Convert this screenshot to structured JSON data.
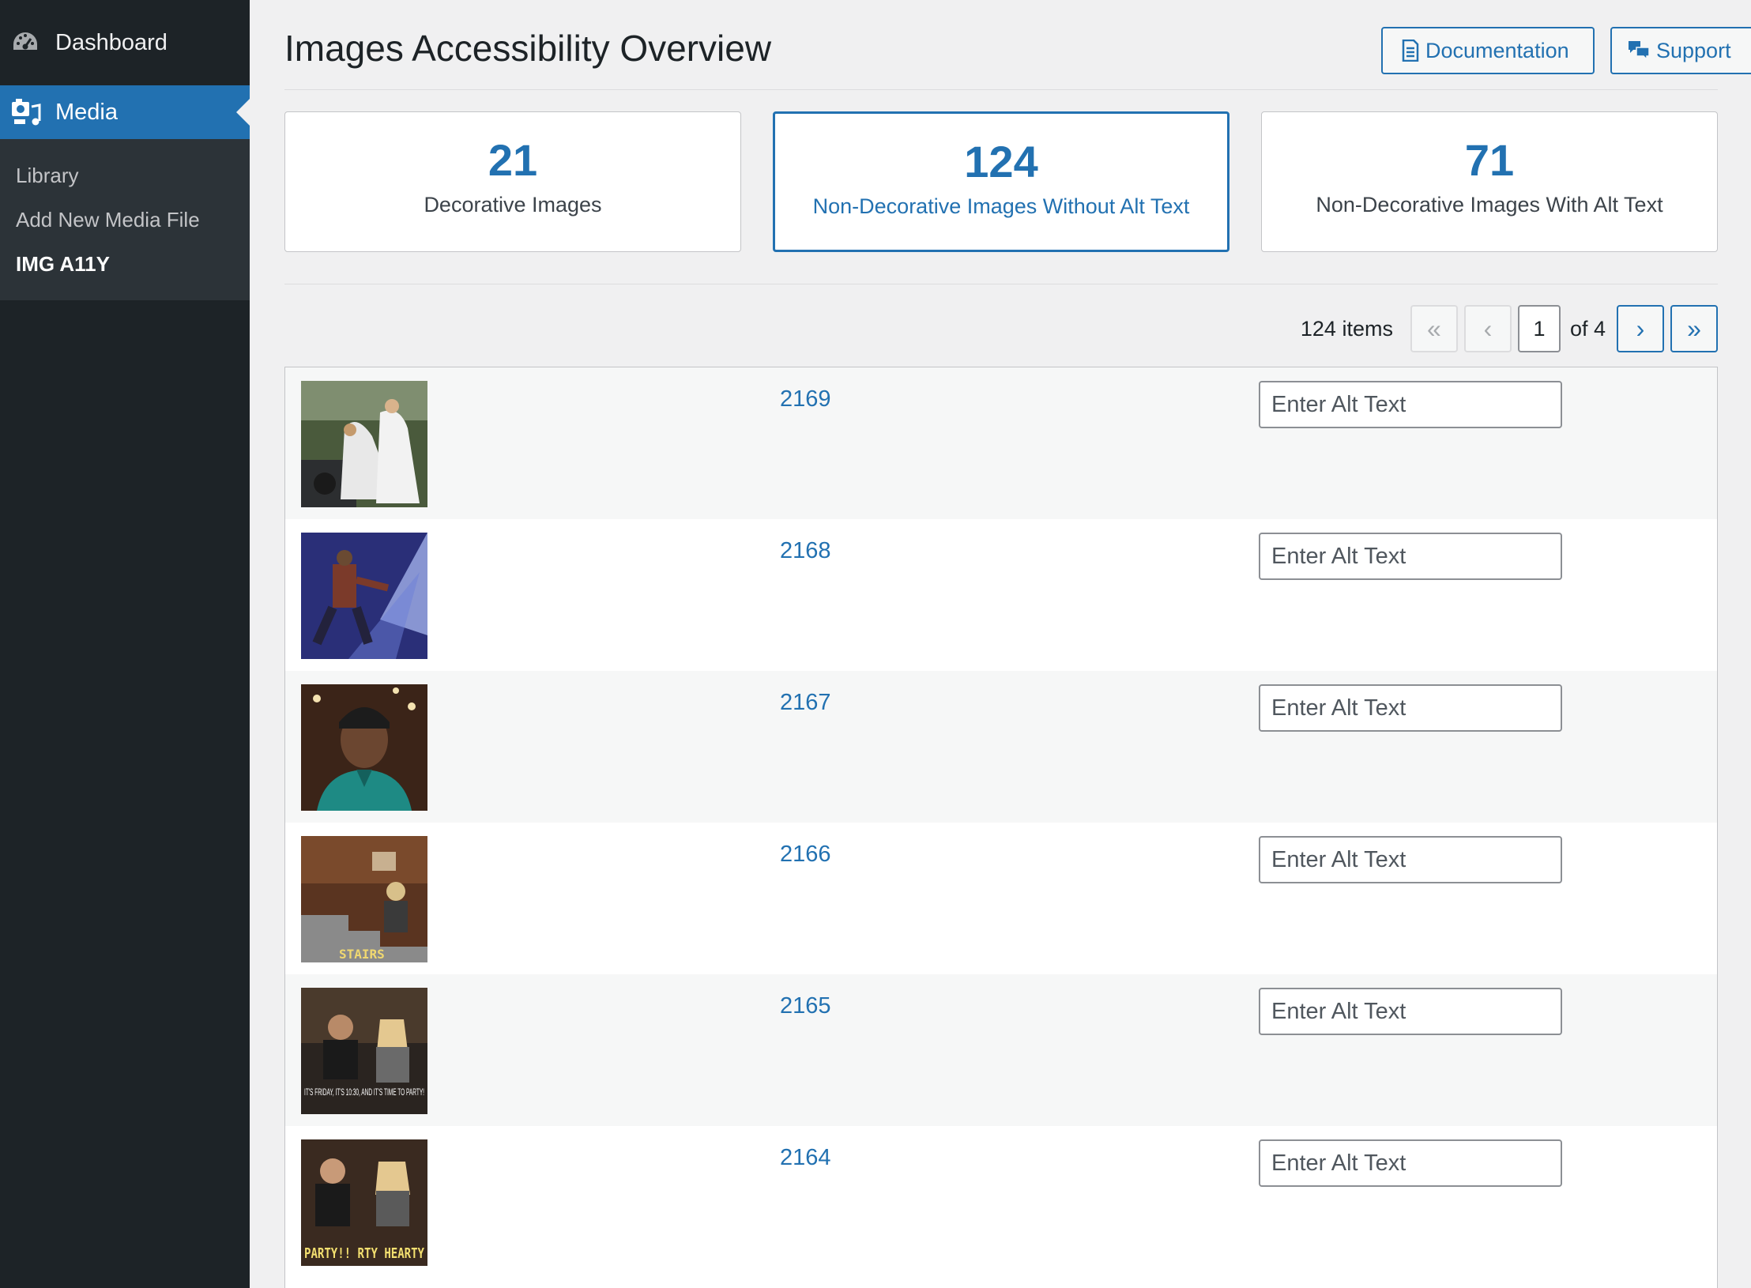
{
  "sidebar": {
    "dashboard_label": "Dashboard",
    "media_label": "Media",
    "submenu": [
      {
        "label": "Library"
      },
      {
        "label": "Add New Media File"
      },
      {
        "label": "IMG A11Y"
      }
    ]
  },
  "header": {
    "title": "Images Accessibility Overview",
    "documentation_label": "Documentation",
    "support_label": "Support"
  },
  "stats": [
    {
      "count": "21",
      "label": "Decorative Images"
    },
    {
      "count": "124",
      "label": "Non-Decorative Images Without Alt Text"
    },
    {
      "count": "71",
      "label": "Non-Decorative Images With Alt Text"
    }
  ],
  "pagination": {
    "items_text": "124 items",
    "first": "«",
    "prev": "‹",
    "current_page": "1",
    "of_text": "of 4",
    "next": "›",
    "last": "»"
  },
  "rows": [
    {
      "id": "2169",
      "placeholder": "Enter Alt Text",
      "thumb_icon": "wedding-photo-thumbnail"
    },
    {
      "id": "2168",
      "placeholder": "Enter Alt Text",
      "thumb_icon": "stage-performer-thumbnail"
    },
    {
      "id": "2167",
      "placeholder": "Enter Alt Text",
      "thumb_icon": "man-portrait-thumbnail"
    },
    {
      "id": "2166",
      "placeholder": "Enter Alt Text",
      "thumb_icon": "stairs-scene-thumbnail",
      "caption": "STAIRS"
    },
    {
      "id": "2165",
      "placeholder": "Enter Alt Text",
      "thumb_icon": "party-scene-thumbnail",
      "caption": "IT'S FRIDAY, IT'S 10:30, AND IT'S TIME TO PARTY!"
    },
    {
      "id": "2164",
      "placeholder": "Enter Alt Text",
      "thumb_icon": "party-hearty-thumbnail",
      "caption": "PARTY!! RTY HEARTY"
    }
  ],
  "colors": {
    "accent": "#2271b1",
    "sidebar_bg": "#1d2327",
    "submenu_bg": "#2c3338"
  }
}
